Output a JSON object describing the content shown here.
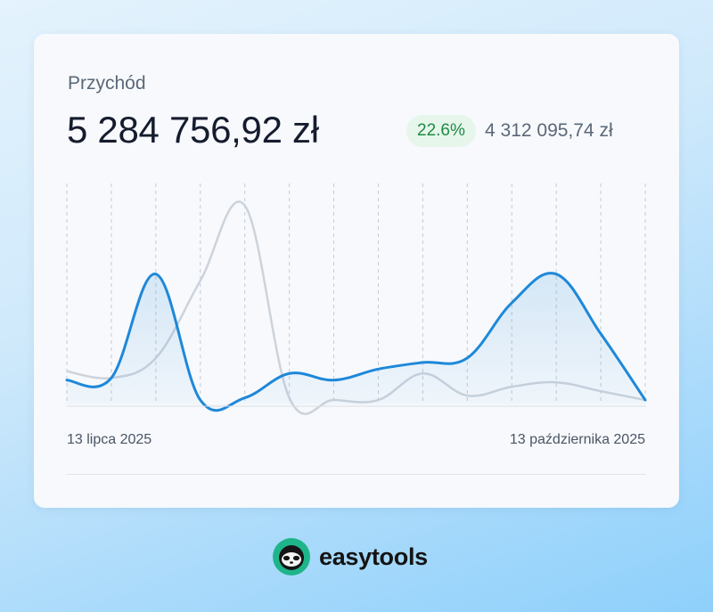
{
  "card": {
    "title": "Przychód",
    "total": "5 284 756,92 zł",
    "change_badge": "22.6%",
    "previous_total": "4 312 095,74 zł",
    "date_start": "13 lipca 2025",
    "date_end": "13 października 2025"
  },
  "brand": {
    "name": "easytools",
    "icon": "sloth-logo-icon"
  },
  "colors": {
    "current_series": "#1e88d9",
    "previous_series": "#cdd3db",
    "badge_bg": "#e6f6ea",
    "badge_text": "#1f8a46",
    "logo_green": "#1fb58a"
  },
  "chart_data": {
    "type": "line",
    "title": "",
    "xlabel": "",
    "ylabel": "",
    "x": [
      0,
      1,
      2,
      3,
      4,
      5,
      6,
      7,
      8,
      9,
      10,
      11,
      12,
      13
    ],
    "ylim": [
      0,
      100
    ],
    "grid": "vertical-dashed",
    "series": [
      {
        "values": [
          11,
          12,
          59,
          2,
          3,
          14,
          11,
          16,
          19,
          21,
          46,
          59,
          32,
          2
        ]
      },
      {
        "values": [
          15,
          12,
          21,
          56,
          90,
          3,
          2,
          2,
          14,
          4,
          8,
          10,
          6,
          2
        ]
      }
    ]
  }
}
